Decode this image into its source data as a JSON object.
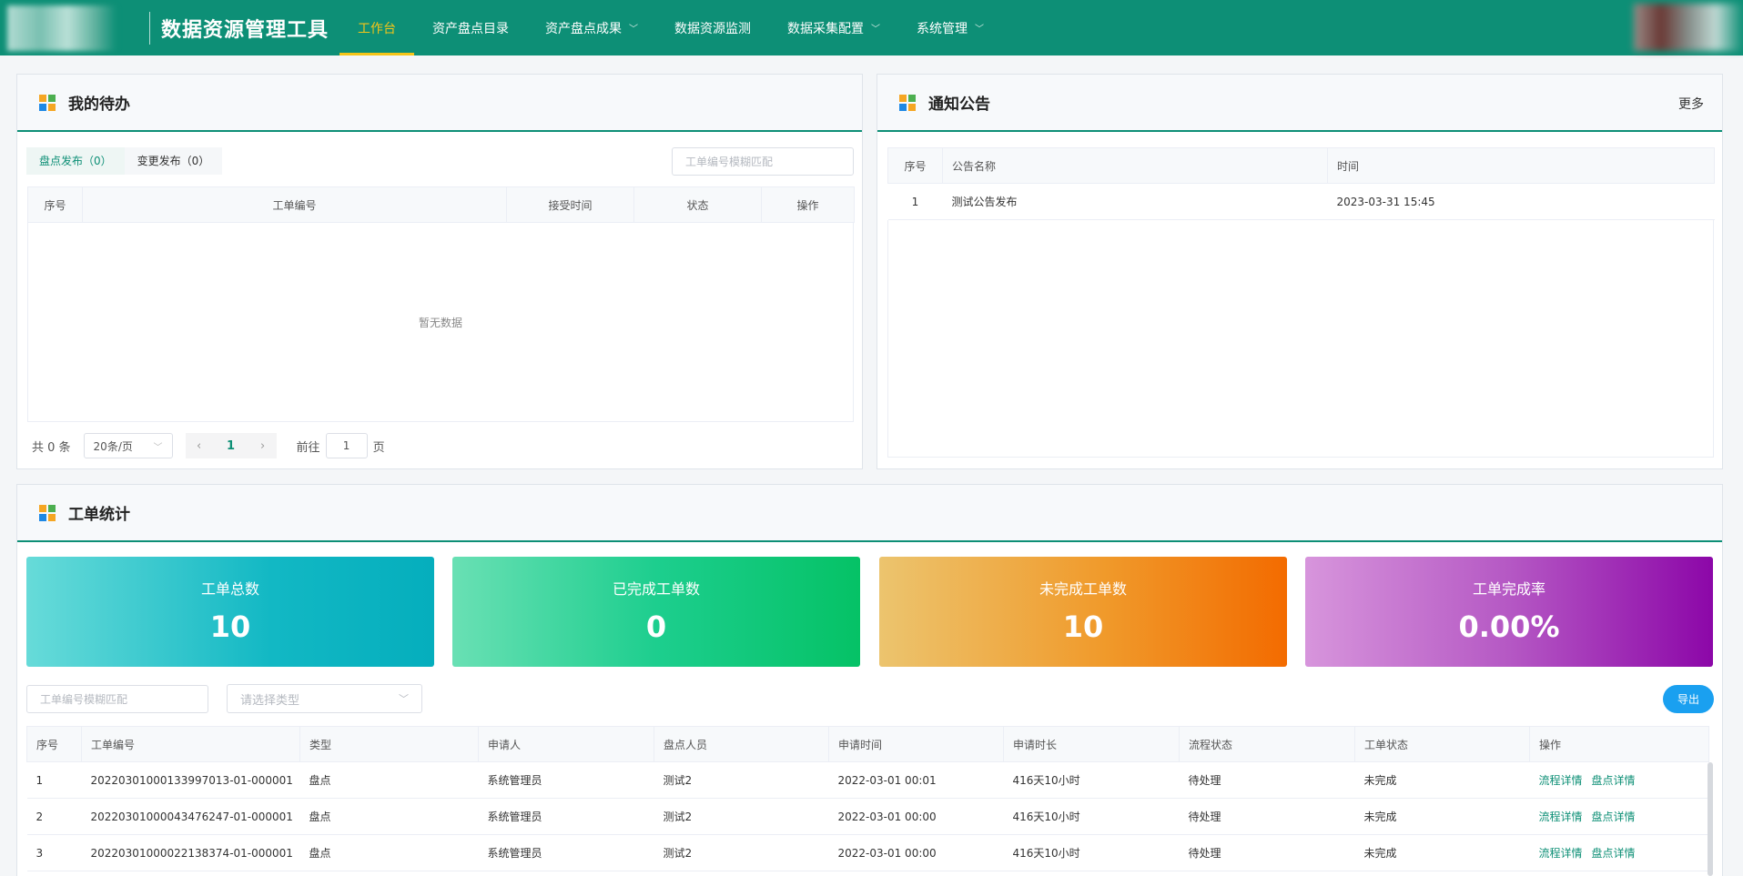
{
  "header": {
    "app_title": "数据资源管理工具",
    "nav": [
      {
        "label": "工作台",
        "active": true,
        "has_dropdown": false
      },
      {
        "label": "资产盘点目录",
        "active": false,
        "has_dropdown": false
      },
      {
        "label": "资产盘点成果",
        "active": false,
        "has_dropdown": true
      },
      {
        "label": "数据资源监测",
        "active": false,
        "has_dropdown": false
      },
      {
        "label": "数据采集配置",
        "active": false,
        "has_dropdown": true
      },
      {
        "label": "系统管理",
        "active": false,
        "has_dropdown": true
      }
    ]
  },
  "todo": {
    "title": "我的待办",
    "tabs": [
      {
        "label": "盘点发布（0）",
        "active": true
      },
      {
        "label": "变更发布（0）",
        "active": false
      }
    ],
    "search_placeholder": "工单编号模糊匹配",
    "columns": [
      "序号",
      "工单编号",
      "接受时间",
      "状态",
      "操作"
    ],
    "empty_text": "暂无数据",
    "pager": {
      "total": "共 0 条",
      "page_size": "20条/页",
      "prev": "‹",
      "current": "1",
      "next": "›",
      "goto_label": "前往",
      "goto_value": "1",
      "page_unit": "页"
    }
  },
  "notice": {
    "title": "通知公告",
    "more": "更多",
    "columns": [
      "序号",
      "公告名称",
      "时间"
    ],
    "rows": [
      {
        "no": "1",
        "name": "测试公告发布",
        "time": "2023-03-31 15:45"
      }
    ]
  },
  "stats": {
    "title": "工单统计",
    "cards": [
      {
        "label": "工单总数",
        "value": "10"
      },
      {
        "label": "已完成工单数",
        "value": "0"
      },
      {
        "label": "未完成工单数",
        "value": "10"
      },
      {
        "label": "工单完成率",
        "value": "0.00%"
      }
    ],
    "search_placeholder": "工单编号模糊匹配",
    "type_placeholder": "请选择类型",
    "export": "导出",
    "columns": [
      "序号",
      "工单编号",
      "类型",
      "申请人",
      "盘点人员",
      "申请时间",
      "申请时长",
      "流程状态",
      "工单状态",
      "操作"
    ],
    "rows": [
      {
        "no": "1",
        "code": "20220301000133997013-01-000001",
        "type": "盘点",
        "applicant": "系统管理员",
        "auditor": "测试2",
        "time": "2022-03-01 00:01",
        "duration": "416天10小时",
        "flow": "待处理",
        "status": "未完成",
        "op1": "流程详情",
        "op2": "盘点详情"
      },
      {
        "no": "2",
        "code": "20220301000043476247-01-000001",
        "type": "盘点",
        "applicant": "系统管理员",
        "auditor": "测试2",
        "time": "2022-03-01 00:00",
        "duration": "416天10小时",
        "flow": "待处理",
        "status": "未完成",
        "op1": "流程详情",
        "op2": "盘点详情"
      },
      {
        "no": "3",
        "code": "20220301000022138374-01-000001",
        "type": "盘点",
        "applicant": "系统管理员",
        "auditor": "测试2",
        "time": "2022-03-01 00:00",
        "duration": "416天10小时",
        "flow": "待处理",
        "status": "未完成",
        "op1": "流程详情",
        "op2": "盘点详情"
      }
    ]
  },
  "colors": {
    "primary": "#0d8f76",
    "active_nav": "#f5c518",
    "export_button": "#1aa0f0"
  }
}
